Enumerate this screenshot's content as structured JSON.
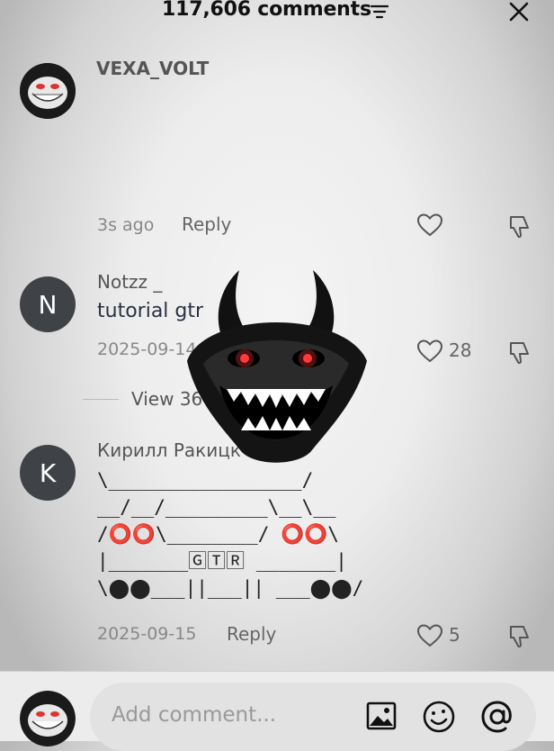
{
  "header": {
    "title": "117,606 comments",
    "sort_icon": "sort-filter-icon",
    "close_icon": "close-icon"
  },
  "comments": [
    {
      "username": "VEXA_VOLT",
      "avatar": "troll-face-avatar",
      "text": "",
      "time": "3s ago",
      "reply_label": "Reply",
      "likes": ""
    },
    {
      "username": "Notzz _",
      "avatar_letter": "N",
      "text": "tutorial gtr",
      "time": "2025-09-14",
      "likes": "28",
      "view_replies": "View 36 r"
    },
    {
      "username": "Кирилл Ракицк",
      "avatar_letter": "K",
      "ascii_lines": [
        "\\_________________/",
        "__/__/_________\\__\\__",
        "/⭕⭕\\________/ ⭕⭕\\",
        "|_______🄶🅃🅁 _______|",
        "\\⬤⬤___||___|| ___⬤⬤/"
      ],
      "time": "2025-09-15",
      "reply_label": "Reply",
      "likes": "5"
    }
  ],
  "composer": {
    "placeholder": "Add comment...",
    "icons": [
      "image-icon",
      "emoji-icon",
      "mention-icon"
    ]
  },
  "overlay": {
    "sticker": "horned-troll-face-sticker"
  }
}
